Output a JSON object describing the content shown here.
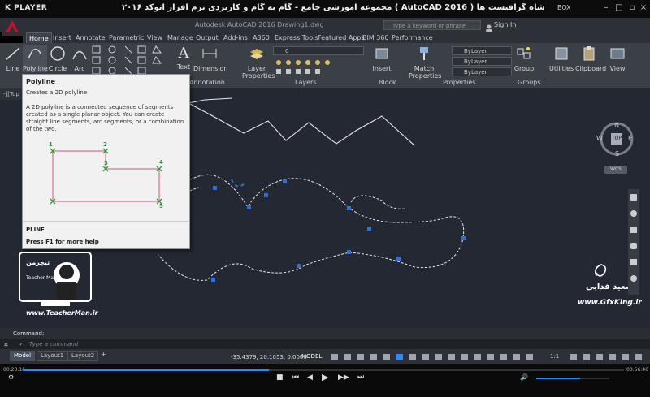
{
  "player": {
    "logo": "K PLAYER",
    "title": "مجموعه آموزشی جامع - گام به گام و کاربردی نرم افزار  اتوکد ۲۰۱۶ ( AutoCAD 2016 )  مدرس : سعید فدایی (تیچرمن) گروه آموزشی پادشاه گرافیست ها",
    "box_label": "BOX",
    "time_elapsed": "00:23:16",
    "time_total": "00:56:46",
    "progress_fraction": 0.41,
    "volume_fraction": 0.6
  },
  "acad": {
    "window_title": "Autodesk AutoCAD 2016    Drawing1.dwg",
    "search_placeholder": "Type a keyword or phrase",
    "sign_in": "Sign In",
    "tabs": [
      "Home",
      "Insert",
      "Annotate",
      "Parametric",
      "View",
      "Manage",
      "Output",
      "Add-ins",
      "A360",
      "Express Tools",
      "Featured Apps",
      "BIM 360",
      "Performance"
    ],
    "tools": {
      "line": "Line",
      "polyline": "Polyline",
      "circle": "Circle",
      "arc": "Arc",
      "text": "Text",
      "dimension": "Dimension",
      "layer_properties": "Layer Properties",
      "insert": "Insert",
      "match_properties": "Match Properties",
      "group": "Group",
      "utilities": "Utilities",
      "clipboard": "Clipboard",
      "view": "View"
    },
    "panels": {
      "annotation": "Annotation",
      "layers": "Layers",
      "block": "Block",
      "properties": "Properties",
      "groups": "Groups"
    },
    "layer_value": "0",
    "bylayer_1": "ByLayer",
    "bylayer_2": "ByLayer",
    "bylayer_3": "ByLayer",
    "file_tab": "-][Top"
  },
  "tooltip": {
    "title": "Polyline",
    "subtitle": "Creates a 2D polyline",
    "description": "A 2D polyline is a connected sequence of segments created as a single planar object. You can create straight line segments, arc segments, or a combination of the two.",
    "points": [
      "1",
      "2",
      "3",
      "4",
      "5"
    ],
    "command": "PLINE",
    "help": "Press F1 for more help"
  },
  "viewcube": {
    "top": "TOP",
    "n": "N",
    "s": "S",
    "e": "E",
    "w": "W",
    "wcs": "WCS"
  },
  "watermark": {
    "site_left": "www.TeacherMan.ir",
    "site_right": "www.GfxKing.ir",
    "sign_right": "سعید فدایی",
    "badge_text": "تیچرمن",
    "badge_sub": "Teacher Man"
  },
  "command": {
    "label": "Command:",
    "placeholder": "Type  a  command"
  },
  "status": {
    "tabs": [
      "Model",
      "Layout1",
      "Layout2"
    ],
    "add_tab": "+",
    "coords": "-35.4379, 20.1053, 0.0000",
    "model": "MODEL",
    "scale": "1:1"
  },
  "colors": {
    "canvas": "#232832",
    "ribbon": "#3b3f46",
    "grip": "#2f6fd8",
    "accent": "#2a8cff"
  }
}
